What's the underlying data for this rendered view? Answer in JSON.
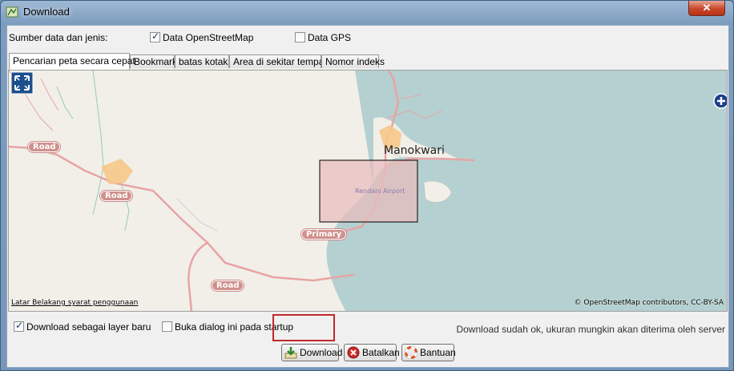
{
  "window": {
    "title": "Download",
    "close_glyph": "✕"
  },
  "source": {
    "label": "Sumber data dan jenis:",
    "osm_label": "Data OpenStreetMap",
    "osm_checked": true,
    "gps_label": "Data GPS",
    "gps_checked": false
  },
  "tabs": [
    {
      "label": "Pencarian peta secara cepat",
      "active": true
    },
    {
      "label": "Bookmark",
      "active": false
    },
    {
      "label": "batas kotak",
      "active": false
    },
    {
      "label": "Area di sekitar tempat",
      "active": false
    },
    {
      "label": "Nomor indeks",
      "active": false
    }
  ],
  "map": {
    "city": "Manokwari",
    "airport": "Rendani Airport",
    "roads": [
      "Road",
      "Road",
      "Primary",
      "Road"
    ],
    "attribution_left": "Latar Belakang syarat penggunaan",
    "attribution_right": "© OpenStreetMap contributors, CC-BY-SA",
    "colors": {
      "land": "#f2efe9",
      "water": "#b5d0d0",
      "road": "#e8a4a4",
      "selection": "#e8c4c4"
    }
  },
  "options": {
    "new_layer_label": "Download sebagai layer baru",
    "new_layer_checked": true,
    "startup_label": "Buka dialog ini pada startup",
    "startup_checked": false,
    "status": "Download sudah ok, ukuran mungkin akan diterima oleh server"
  },
  "buttons": {
    "download": "Download",
    "cancel": "Batalkan",
    "help": "Bantuan"
  }
}
